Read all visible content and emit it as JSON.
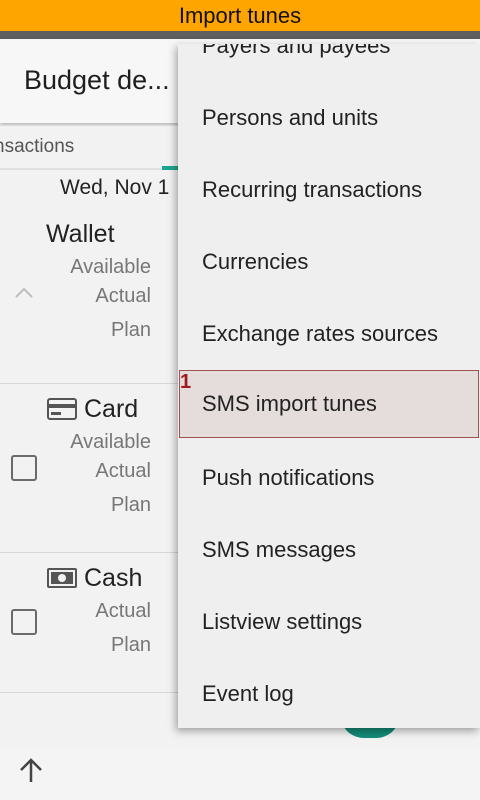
{
  "banner": {
    "title": "Import tunes"
  },
  "appbar": {
    "title": "Budget de..."
  },
  "tabs": {
    "transactions_label": "nsactions"
  },
  "date_label": "Wed, Nov 1",
  "accounts": [
    {
      "name": "Wallet",
      "lines": [
        "Available",
        "Actual",
        "Plan"
      ]
    },
    {
      "name": "Card",
      "lines": [
        "Available",
        "Actual",
        "Plan"
      ]
    },
    {
      "name": "Cash",
      "lines": [
        "Actual",
        "Plan"
      ]
    }
  ],
  "menu": {
    "items": [
      "Payers and payees",
      "Persons and units",
      "Recurring transactions",
      "Currencies",
      "Exchange rates sources",
      "SMS import tunes",
      "Push notifications",
      "SMS messages",
      "Listview settings",
      "Event log"
    ],
    "highlight_badge": "1"
  },
  "colors": {
    "banner": "#ffa500",
    "accent": "#1aa791",
    "highlight_border": "#a05050",
    "badge": "#a01c1c"
  },
  "icons": [
    "chevron-up-icon",
    "card-icon",
    "cash-icon",
    "arrow-up-icon"
  ]
}
